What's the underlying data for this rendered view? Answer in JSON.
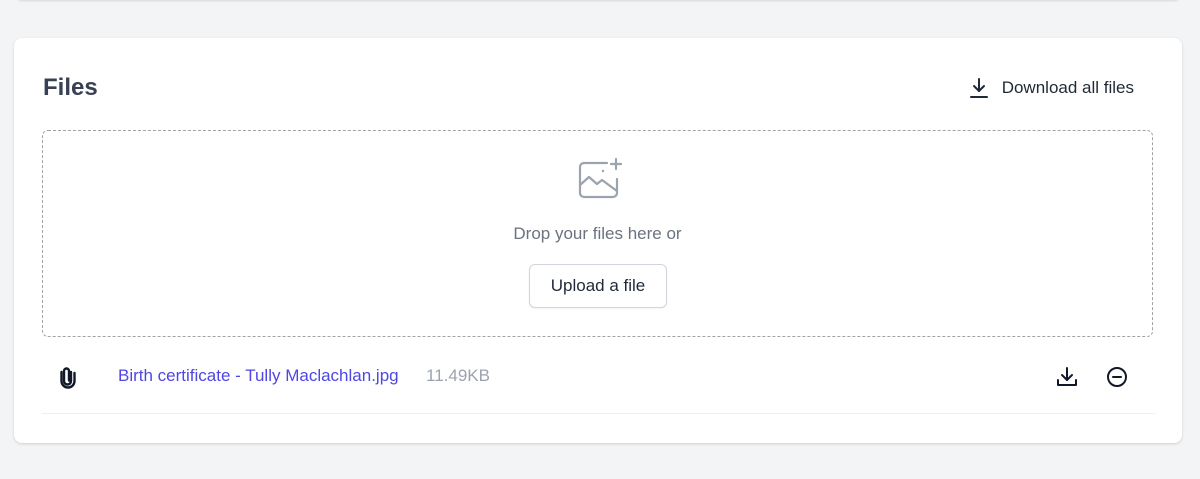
{
  "files_card": {
    "title": "Files",
    "download_all_label": "Download all files",
    "download_all_icon": "download-icon"
  },
  "dropzone": {
    "icon": "image-add-icon",
    "prompt": "Drop your files here or",
    "upload_label": "Upload a file"
  },
  "files": [
    {
      "icon": "paperclip-icon",
      "name": "Birth certificate - Tully Maclachlan.jpg",
      "size": "11.49KB",
      "actions": [
        "download-icon",
        "remove-icon"
      ]
    }
  ],
  "colors": {
    "background": "#f3f4f6",
    "card": "#ffffff",
    "title": "#374151",
    "link": "#4f46e5",
    "muted": "#6b7280",
    "size_text": "#9ca3af",
    "dropzone_border": "#a3a3a3"
  }
}
